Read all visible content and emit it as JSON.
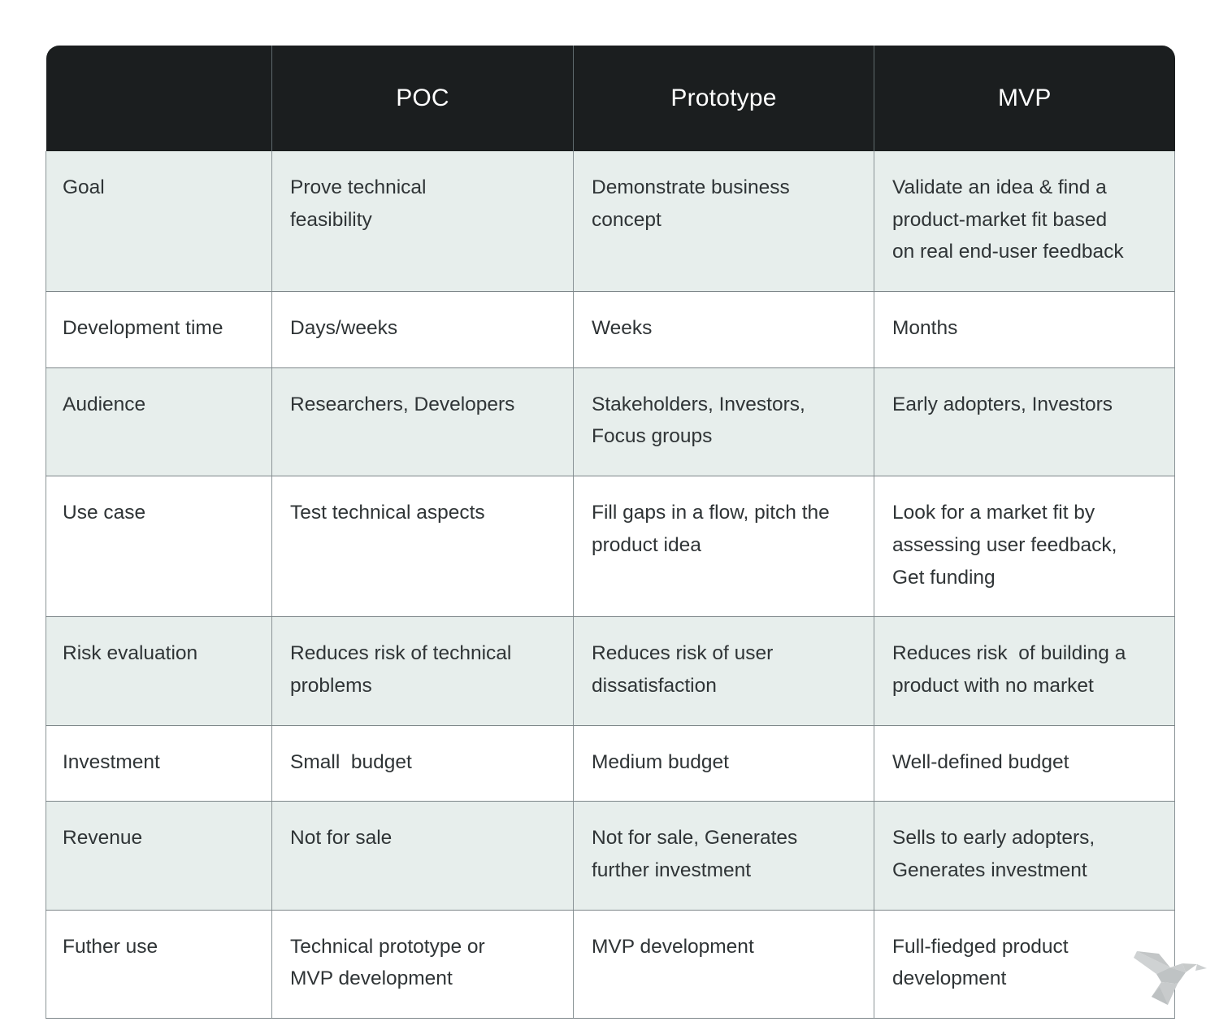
{
  "table": {
    "columns": [
      "",
      "POC",
      "Prototype",
      "MVP"
    ],
    "rows": [
      {
        "label": "Goal",
        "poc": "Prove technical\nfeasibility",
        "prototype": "Demonstrate business\nconcept",
        "mvp": "Validate an idea & find a\nproduct-market fit based\non real end-user feedback"
      },
      {
        "label": "Development time",
        "poc": "Days/weeks",
        "prototype": "Weeks",
        "mvp": "Months"
      },
      {
        "label": "Audience",
        "poc": "Researchers, Developers",
        "prototype": "Stakeholders, Investors,\nFocus groups",
        "mvp": "Early adopters, Investors"
      },
      {
        "label": "Use case",
        "poc": "Test technical aspects",
        "prototype": "Fill gaps in a flow, pitch the\nproduct idea",
        "mvp": "Look for a market fit by\nassessing user feedback,\nGet funding"
      },
      {
        "label": "Risk evaluation",
        "poc": "Reduces risk of technical\nproblems",
        "prototype": "Reduces risk of user\ndissatisfaction",
        "mvp": "Reduces risk  of building a\nproduct with no market"
      },
      {
        "label": "Investment",
        "poc": "Small  budget",
        "prototype": "Medium budget",
        "mvp": "Well-defined budget"
      },
      {
        "label": "Revenue",
        "poc": "Not for sale",
        "prototype": "Not for sale, Generates\nfurther investment",
        "mvp": "Sells to early adopters,\nGenerates investment"
      },
      {
        "label": "Futher use",
        "poc": "Technical prototype or\nMVP development",
        "prototype": "MVP development",
        "mvp": "Full-fiedged product\ndevelopment"
      }
    ]
  },
  "logo": {
    "name": "origami-bird-logo",
    "color": "#c3c6c7"
  },
  "colors": {
    "header_bg": "#1b1e1f",
    "header_text": "#ffffff",
    "row_alt_bg": "#e7eeec",
    "row_bg": "#ffffff",
    "body_text": "#2f3436",
    "border": "#8b9497"
  }
}
